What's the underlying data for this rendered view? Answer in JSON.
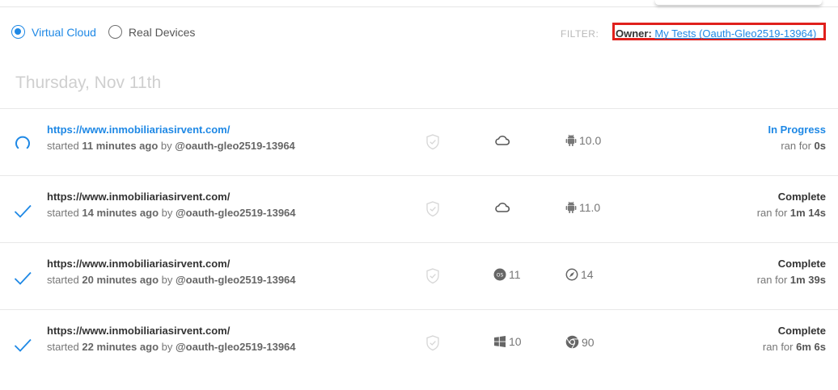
{
  "env_toggle": {
    "options": [
      {
        "label": "Virtual Cloud",
        "selected": true
      },
      {
        "label": "Real Devices",
        "selected": false
      }
    ]
  },
  "filter": {
    "label": "FILTER:",
    "owner_key": "Owner:",
    "owner_value": "My Tests (Oauth-Gleo2519-13964)"
  },
  "date_heading": "Thursday, Nov 11th",
  "meta_words": {
    "started": "started",
    "by": "by",
    "ran_for": "ran for"
  },
  "tests": [
    {
      "url": "https://www.inmobiliariasirvent.com/",
      "started_ago": "11 minutes ago",
      "user": "@oauth-gleo2519-13964",
      "os_icon": "cloud-icon",
      "os_version": "",
      "platform_icon": "android-icon",
      "platform_version": "10.0",
      "status": "In Progress",
      "status_icon": "spinner-icon",
      "duration": "0s"
    },
    {
      "url": "https://www.inmobiliariasirvent.com/",
      "started_ago": "14 minutes ago",
      "user": "@oauth-gleo2519-13964",
      "os_icon": "cloud-icon",
      "os_version": "",
      "platform_icon": "android-icon",
      "platform_version": "11.0",
      "status": "Complete",
      "status_icon": "check-icon",
      "duration": "1m 14s"
    },
    {
      "url": "https://www.inmobiliariasirvent.com/",
      "started_ago": "20 minutes ago",
      "user": "@oauth-gleo2519-13964",
      "os_icon": "macos-icon",
      "os_version": "11",
      "platform_icon": "safari-icon",
      "platform_version": "14",
      "status": "Complete",
      "status_icon": "check-icon",
      "duration": "1m 39s"
    },
    {
      "url": "https://www.inmobiliariasirvent.com/",
      "started_ago": "22 minutes ago",
      "user": "@oauth-gleo2519-13964",
      "os_icon": "windows-icon",
      "os_version": "10",
      "platform_icon": "chrome-icon",
      "platform_version": "90",
      "status": "Complete",
      "status_icon": "check-icon",
      "duration": "6m 6s"
    }
  ],
  "colors": {
    "accent": "#1e88e5",
    "highlight_box": "#e0201c",
    "muted": "#cfcfcf"
  }
}
